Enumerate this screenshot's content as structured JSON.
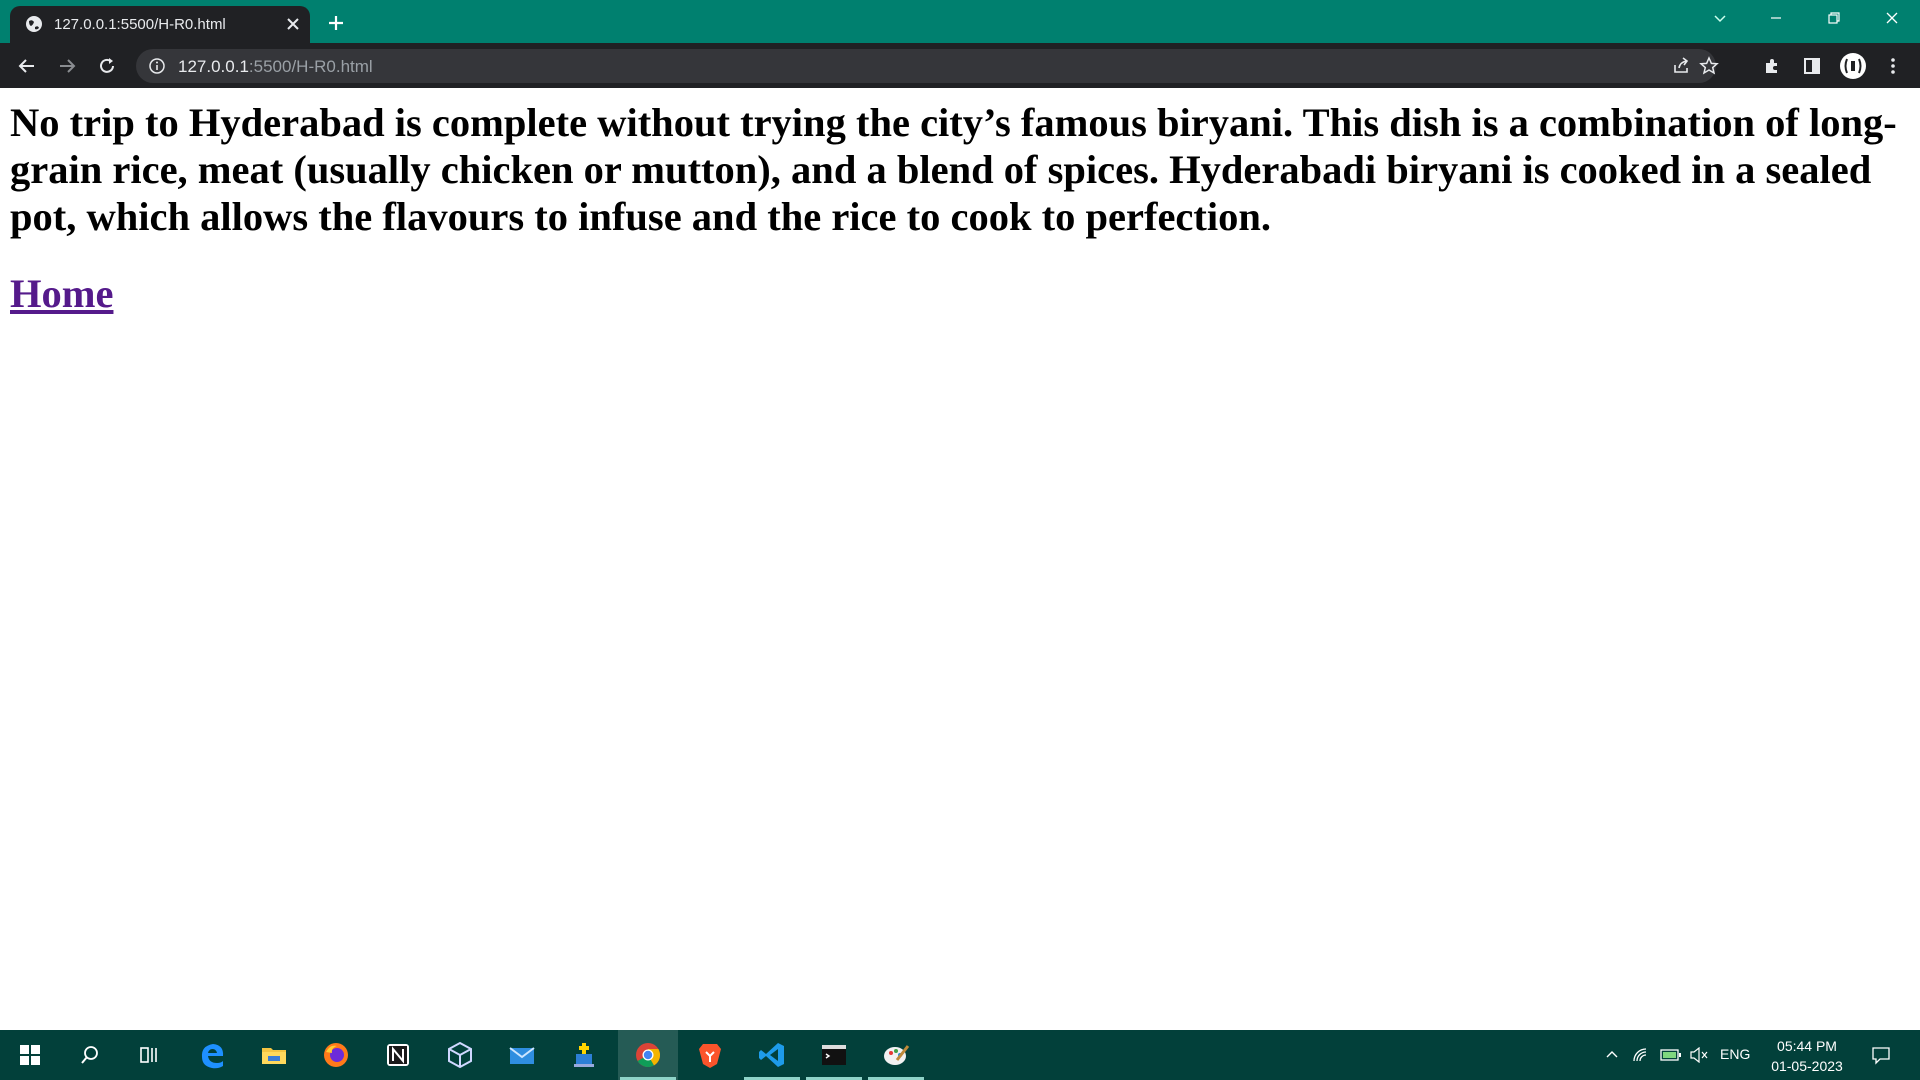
{
  "browser": {
    "tab_title": "127.0.0.1:5500/H-R0.html",
    "url_host": "127.0.0.1",
    "url_path": ":5500/H-R0.html",
    "tab_color": "#00806f",
    "toolbar_color": "#202124"
  },
  "page": {
    "paragraph": "No trip to Hyderabad is complete without trying the city’s famous biryani. This dish is a combination of long-grain rice, meat (usually chicken or mutton), and a blend of spices. Hyderabadi biryani is cooked in a sealed pot, which allows the flavours to infuse and the rice to cook to perfection.",
    "home_link": "Home",
    "link_color": "#551a8b"
  },
  "taskbar": {
    "apps": [
      "windows-start",
      "search",
      "task-view",
      "edge",
      "file-explorer",
      "firefox",
      "notion",
      "virtualbox",
      "mail",
      "app",
      "chrome",
      "brave",
      "vscode",
      "terminal",
      "paint"
    ],
    "active_app": "chrome",
    "language": "ENG",
    "time": "05:44 PM",
    "date": "01-05-2023"
  }
}
